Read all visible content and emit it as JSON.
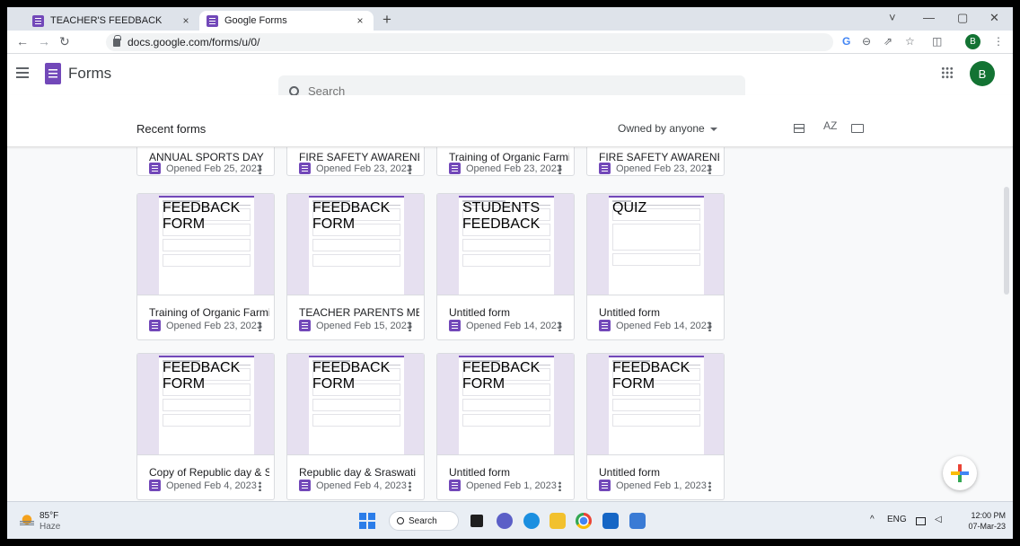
{
  "browser": {
    "tabs": [
      {
        "label": "TEACHER'S FEEDBACK",
        "active": false
      },
      {
        "label": "Google Forms",
        "active": true
      }
    ],
    "new_tab": "+",
    "close": "×",
    "url": "docs.google.com/forms/u/0/",
    "profile_initial": "B",
    "window_controls": [
      "˅",
      "—",
      "▢",
      "✕"
    ],
    "toolbar_icons": [
      "G",
      "⊖",
      "⇗",
      "☆",
      "◫",
      "⋮"
    ]
  },
  "app": {
    "title": "Forms",
    "search_placeholder": "Search",
    "avatar_initial": "B"
  },
  "recent": {
    "title": "Recent forms",
    "owner_filter": "Owned by anyone",
    "sort_label": "AZ"
  },
  "forms": [
    {
      "name": "ANNUAL SPORTS DAY",
      "opened": "Opened Feb 25, 2023"
    },
    {
      "name": "FIRE SAFETY AWARENESS...",
      "opened": "Opened Feb 23, 2023"
    },
    {
      "name": "Training of Organic Farmi...",
      "opened": "Opened Feb 23, 2023"
    },
    {
      "name": "FIRE SAFETY AWARENESS...",
      "opened": "Opened Feb 23, 2023"
    },
    {
      "name": "Training of Organic Farmi...",
      "opened": "Opened Feb 23, 2023"
    },
    {
      "name": "TEACHER PARENTS MEETI...",
      "opened": "Opened Feb 15, 2023"
    },
    {
      "name": "Untitled form",
      "opened": "Opened Feb 14, 2023"
    },
    {
      "name": "Untitled form",
      "opened": "Opened Feb 14, 2023"
    },
    {
      "name": "Copy of Republic day & Sr...",
      "opened": "Opened Feb 4, 2023"
    },
    {
      "name": "Republic day & Sraswati P...",
      "opened": "Opened Feb 4, 2023"
    },
    {
      "name": "Untitled form",
      "opened": "Opened Feb 1, 2023"
    },
    {
      "name": "Untitled form",
      "opened": "Opened Feb 1, 2023"
    }
  ],
  "thumb_titles": [
    "FEEDBACK FORM",
    "FEEDBACK FORM",
    "STUDENTS FEEDBACK",
    "QUIZ",
    "FEEDBACK FORM",
    "FEEDBACK FORM",
    "FEEDBACK FORM",
    "FEEDBACK FORM"
  ],
  "taskbar": {
    "temperature": "85°F",
    "condition": "Haze",
    "search_label": "Search",
    "language": "ENG",
    "tray_up": "^",
    "time": "12:00 PM",
    "date": "07-Mar-23"
  },
  "colors": {
    "forms_purple": "#7248b9",
    "avatar_green": "#137333",
    "accent_blue": "#4285f4"
  }
}
